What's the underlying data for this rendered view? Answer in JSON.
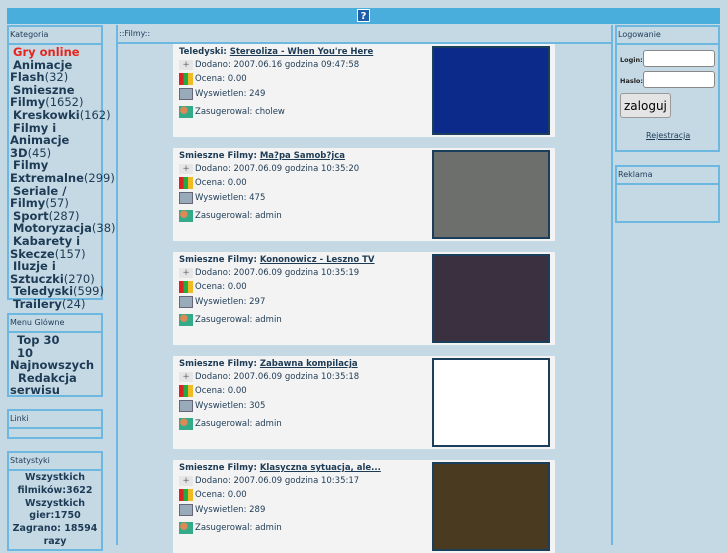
{
  "header": {
    "help_label": "?"
  },
  "kategoria": {
    "title": "Kategoria",
    "items": [
      {
        "label": "Gry online",
        "count": ""
      },
      {
        "label": "Animacje Flash",
        "count": "(32)"
      },
      {
        "label": "Smieszne Filmy",
        "count": "(1652)"
      },
      {
        "label": "Kreskowki",
        "count": "(162)"
      },
      {
        "label": "Filmy i Animacje 3D",
        "count": "(45)"
      },
      {
        "label": "Filmy Extremalne",
        "count": "(299)"
      },
      {
        "label": "Seriale / Filmy",
        "count": "(57)"
      },
      {
        "label": "Sport",
        "count": "(287)"
      },
      {
        "label": "Motoryzacja",
        "count": "(38)"
      },
      {
        "label": "Kabarety i Skecze",
        "count": "(157)"
      },
      {
        "label": "Iluzje i Sztuczki",
        "count": "(270)"
      },
      {
        "label": "Teledyski",
        "count": "(599)"
      },
      {
        "label": "Trailery",
        "count": "(24)"
      }
    ]
  },
  "menu": {
    "title": "Menu Glówne",
    "items": [
      "Top 30",
      "10 Najnowszych",
      "Redakcja serwisu"
    ]
  },
  "linki": {
    "title": "Linki"
  },
  "statystyki": {
    "title": "Statystyki",
    "lines": [
      "Wszystkich filmików:3622",
      "Wszystkich gier:1750",
      "Zagrano: 18594 razy"
    ]
  },
  "main": {
    "title": "::Filmy::",
    "films": [
      {
        "category": "Teledyski:",
        "title": "Stereoliza - When You're Here",
        "added": "Dodano: 2007.06.16 godzina 09:47:58",
        "rating": "Ocena: 0.00",
        "views": "Wyswietlen: 249",
        "by": "Zasugerowal: cholew",
        "thumb": "#0b2a8a"
      },
      {
        "category": "Smieszne Filmy:",
        "title": "Ma?pa Samob?jca",
        "added": "Dodano: 2007.06.09 godzina 10:35:20",
        "rating": "Ocena: 0.00",
        "views": "Wyswietlen: 475",
        "by": "Zasugerowal: admin",
        "thumb": "#6d6f6c"
      },
      {
        "category": "Smieszne Filmy:",
        "title": "Kononowicz - Leszno TV",
        "added": "Dodano: 2007.06.09 godzina 10:35:19",
        "rating": "Ocena: 0.00",
        "views": "Wyswietlen: 297",
        "by": "Zasugerowal: admin",
        "thumb": "#3a3040"
      },
      {
        "category": "Smieszne Filmy:",
        "title": "Zabawna kompilacja",
        "added": "Dodano: 2007.06.09 godzina 10:35:18",
        "rating": "Ocena: 0.00",
        "views": "Wyswietlen: 305",
        "by": "Zasugerowal: admin",
        "thumb": "#ffffff"
      },
      {
        "category": "Smieszne Filmy:",
        "title": "Klasyczna sytuacja, ale...",
        "added": "Dodano: 2007.06.09 godzina 10:35:17",
        "rating": "Ocena: 0.00",
        "views": "Wyswietlen: 289",
        "by": "Zasugerowal: admin",
        "thumb": "#4a3a20"
      }
    ]
  },
  "login": {
    "title": "Logowanie",
    "login_label": "Login:",
    "password_label": "Haslo:",
    "submit": "zaloguj",
    "register": "Rejestracja"
  },
  "reklama": {
    "title": "Reklama"
  }
}
